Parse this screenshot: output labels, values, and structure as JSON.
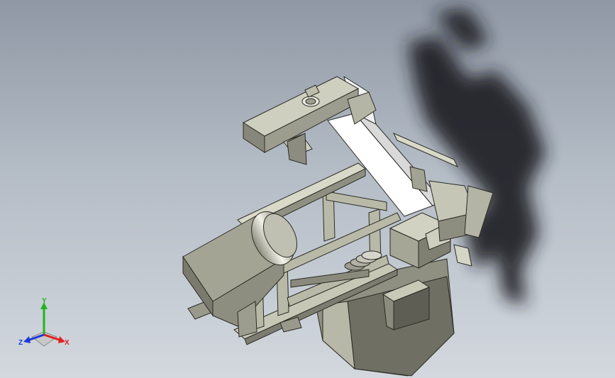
{
  "viewport": {
    "background_top": "#8f98a4",
    "background_bottom": "#d3d8de"
  },
  "model": {
    "metal_light": "#d4d4c4",
    "metal_mid": "#a9a999",
    "metal_dark": "#6f6f64",
    "belt": "#ffffff",
    "shadow": "#1c1f24"
  },
  "triad": {
    "x_label": "X",
    "y_label": "Y",
    "z_label": "Z",
    "x_color": "#e02020",
    "y_color": "#1eb61e",
    "z_color": "#1a3ad8"
  }
}
